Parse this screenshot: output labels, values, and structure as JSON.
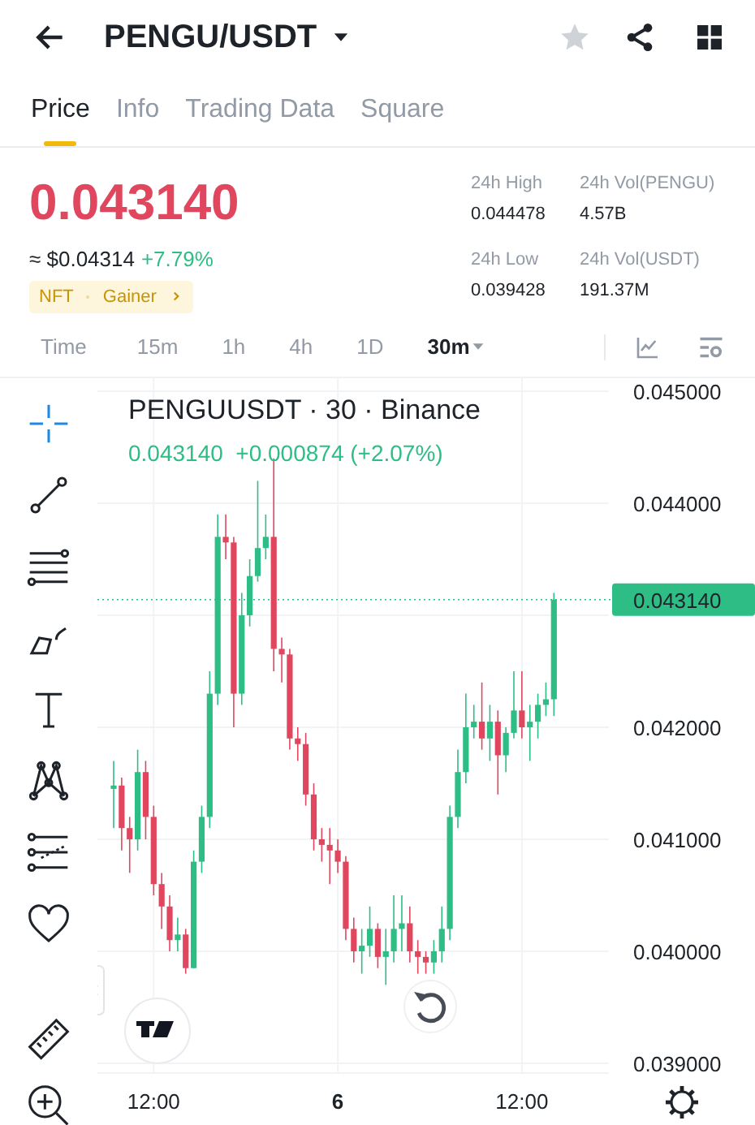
{
  "header": {
    "title": "PENGU/USDT",
    "favorite": false
  },
  "tabs": [
    {
      "label": "Price",
      "selected": true
    },
    {
      "label": "Info",
      "selected": false
    },
    {
      "label": "Trading Data",
      "selected": false
    },
    {
      "label": "Square",
      "selected": false
    }
  ],
  "price": {
    "last": "0.043140",
    "usd": "≈ $0.04314",
    "change": "+7.79%",
    "tags": [
      "NFT",
      "Gainer"
    ]
  },
  "stats": [
    {
      "label": "24h High",
      "value": "0.044478"
    },
    {
      "label": "24h Vol(PENGU)",
      "value": "4.57B"
    },
    {
      "label": "24h Low",
      "value": "0.039428"
    },
    {
      "label": "24h Vol(USDT)",
      "value": "191.37M"
    }
  ],
  "timeframes": [
    {
      "label": "Time",
      "kind": "label"
    },
    {
      "label": "15m",
      "selected": false,
      "kind": "option"
    },
    {
      "label": "1h",
      "selected": false,
      "kind": "option"
    },
    {
      "label": "4h",
      "selected": false,
      "kind": "option"
    },
    {
      "label": "1D",
      "selected": false,
      "kind": "option"
    },
    {
      "label": "30m",
      "selected": true,
      "kind": "dropdown"
    }
  ],
  "tools": [
    {
      "selected": true
    },
    {
      "selected": false
    },
    {
      "selected": false
    },
    {
      "selected": false
    },
    {
      "selected": false
    },
    {
      "selected": false
    },
    {
      "selected": false
    },
    {
      "selected": false
    },
    {
      "selected": false
    },
    {
      "selected": false
    }
  ],
  "chart": {
    "legend_title": "PENGUUSDT · 30 · Binance",
    "legend_price": "0.043140",
    "legend_change": "+0.000874 (+2.07%)",
    "price_tag": "0.043140",
    "chart_data": {
      "type": "candlestick",
      "ylim": [
        0.039,
        0.045
      ],
      "grid": true,
      "ref_lines": [
        {
          "axis": "y",
          "value": 0.04314
        }
      ],
      "categories": [
        null,
        null,
        null,
        null,
        null,
        "12:00",
        null,
        null,
        null,
        null,
        null,
        null,
        null,
        null,
        null,
        null,
        null,
        null,
        null,
        null,
        null,
        null,
        null,
        null,
        null,
        null,
        null,
        null,
        "6",
        null,
        null,
        null,
        null,
        null,
        null,
        null,
        null,
        null,
        null,
        null,
        null,
        null,
        null,
        null,
        null,
        null,
        null,
        null,
        null,
        null,
        null,
        "12:00",
        null,
        null,
        null,
        null
      ],
      "yticks": [
        {
          "value": 0.045,
          "label": "0.045000"
        },
        {
          "value": 0.044,
          "label": "0.044000"
        },
        {
          "value": 0.042,
          "label": "0.042000"
        },
        {
          "value": 0.041,
          "label": "0.041000"
        },
        {
          "value": 0.04,
          "label": "0.040000"
        },
        {
          "value": 0.039,
          "label": "0.039000"
        }
      ],
      "ohlc": [
        [
          0.04145,
          0.0417,
          0.0411,
          0.04148
        ],
        [
          0.04148,
          0.04155,
          0.0409,
          0.0411
        ],
        [
          0.0411,
          0.0412,
          0.0407,
          0.041
        ],
        [
          0.041,
          0.0418,
          0.0409,
          0.0416
        ],
        [
          0.0416,
          0.0417,
          0.041,
          0.0412
        ],
        [
          0.0412,
          0.0413,
          0.0405,
          0.0406
        ],
        [
          0.0406,
          0.0407,
          0.0402,
          0.0404
        ],
        [
          0.0404,
          0.0405,
          0.04,
          0.0401
        ],
        [
          0.0401,
          0.0403,
          0.04,
          0.04015
        ],
        [
          0.04015,
          0.0402,
          0.0398,
          0.03985
        ],
        [
          0.03985,
          0.0409,
          0.03985,
          0.0408
        ],
        [
          0.0408,
          0.0413,
          0.0407,
          0.0412
        ],
        [
          0.0412,
          0.0425,
          0.0411,
          0.0423
        ],
        [
          0.0423,
          0.0439,
          0.0422,
          0.0437
        ],
        [
          0.0437,
          0.0439,
          0.0435,
          0.04365
        ],
        [
          0.04365,
          0.0437,
          0.042,
          0.0423
        ],
        [
          0.0423,
          0.0432,
          0.0422,
          0.043
        ],
        [
          0.043,
          0.0435,
          0.0429,
          0.04335
        ],
        [
          0.04335,
          0.0442,
          0.0433,
          0.0436
        ],
        [
          0.0436,
          0.0439,
          0.0435,
          0.0437
        ],
        [
          0.0437,
          0.0444,
          0.0425,
          0.0427
        ],
        [
          0.0427,
          0.0428,
          0.0424,
          0.04265
        ],
        [
          0.04265,
          0.0427,
          0.0418,
          0.0419
        ],
        [
          0.0419,
          0.042,
          0.0417,
          0.04185
        ],
        [
          0.04185,
          0.04195,
          0.0413,
          0.0414
        ],
        [
          0.0414,
          0.0415,
          0.0409,
          0.041
        ],
        [
          0.041,
          0.0411,
          0.0408,
          0.04095
        ],
        [
          0.04095,
          0.0411,
          0.0406,
          0.0409
        ],
        [
          0.0409,
          0.041,
          0.0407,
          0.0408
        ],
        [
          0.0408,
          0.04085,
          0.0401,
          0.0402
        ],
        [
          0.0402,
          0.0403,
          0.0399,
          0.04
        ],
        [
          0.04,
          0.0402,
          0.0398,
          0.04005
        ],
        [
          0.04005,
          0.0404,
          0.03995,
          0.0402
        ],
        [
          0.0402,
          0.04025,
          0.03985,
          0.03995
        ],
        [
          0.03995,
          0.0402,
          0.0397,
          0.04
        ],
        [
          0.04,
          0.0405,
          0.0399,
          0.0402
        ],
        [
          0.0402,
          0.0405,
          0.04,
          0.04025
        ],
        [
          0.04025,
          0.0404,
          0.0399,
          0.04
        ],
        [
          0.04,
          0.0401,
          0.0398,
          0.03995
        ],
        [
          0.03995,
          0.04,
          0.0398,
          0.0399
        ],
        [
          0.0399,
          0.0401,
          0.0398,
          0.04
        ],
        [
          0.04,
          0.0404,
          0.0399,
          0.0402
        ],
        [
          0.0402,
          0.0413,
          0.0401,
          0.0412
        ],
        [
          0.0412,
          0.0418,
          0.0411,
          0.0416
        ],
        [
          0.0416,
          0.0423,
          0.0415,
          0.042
        ],
        [
          0.042,
          0.0422,
          0.0419,
          0.04205
        ],
        [
          0.04205,
          0.0424,
          0.0418,
          0.0419
        ],
        [
          0.0419,
          0.0422,
          0.0417,
          0.04205
        ],
        [
          0.04205,
          0.04215,
          0.0414,
          0.04175
        ],
        [
          0.04175,
          0.042,
          0.0416,
          0.04195
        ],
        [
          0.04195,
          0.0425,
          0.0419,
          0.04215
        ],
        [
          0.04215,
          0.0425,
          0.0419,
          0.042
        ],
        [
          0.042,
          0.0422,
          0.0417,
          0.04205
        ],
        [
          0.04205,
          0.0423,
          0.0419,
          0.0422
        ],
        [
          0.0422,
          0.0424,
          0.0421,
          0.04225
        ],
        [
          0.04225,
          0.0432,
          0.0421,
          0.04314
        ]
      ]
    }
  }
}
